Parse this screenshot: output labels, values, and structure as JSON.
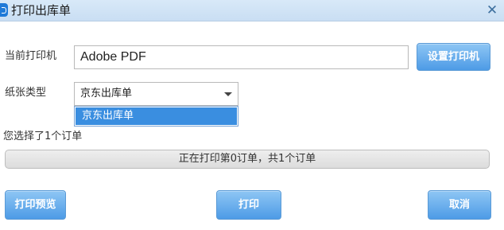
{
  "window": {
    "title": "打印出库单",
    "close_icon": "close-icon"
  },
  "form": {
    "printer_label": "当前打印机",
    "printer_value": "Adobe PDF",
    "setup_button": "设置打印机",
    "paper_label": "纸张类型",
    "paper_selected": "京东出库单",
    "paper_options": [
      "京东出库单"
    ]
  },
  "status": {
    "selected_count": "您选择了1个订单",
    "progress_text": "正在打印第0订单，共1个订单",
    "progress_fraction": 0
  },
  "buttons": {
    "preview": "打印预览",
    "print": "打印",
    "cancel": "取消"
  },
  "colors": {
    "accent": "#4d9be6",
    "dropdown_highlight": "#3a8ee0"
  }
}
